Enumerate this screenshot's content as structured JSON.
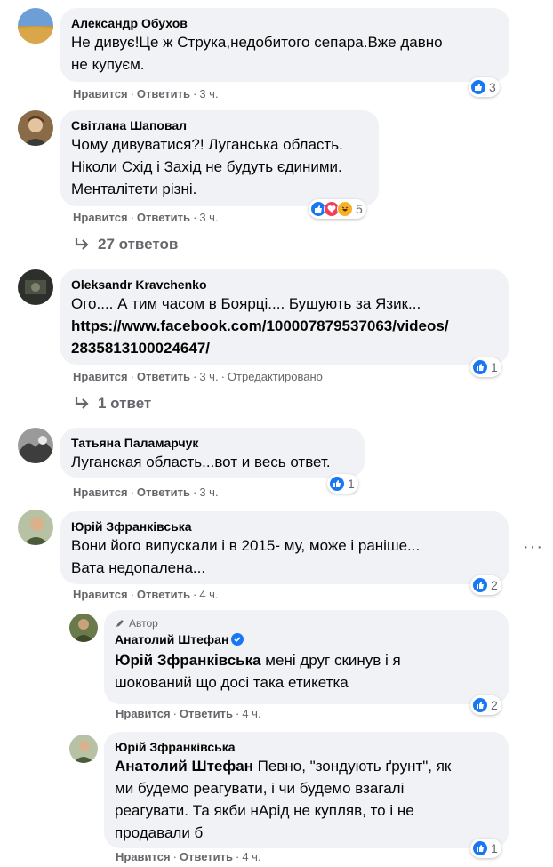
{
  "comments": [
    {
      "author": "Александр Обухов",
      "text": "Не дивує!Це ж Струка,недобитого сепара.Вже давно\nне купуєм.",
      "like": "Нравится",
      "reply": "Ответить",
      "time": "3 ч.",
      "reactions": "3"
    },
    {
      "author": "Світлана Шаповал",
      "text": "Чому дивуватися?! Луганська область.\nНіколи Схід і Захід не будуть єдиними.\nМенталітети різні.",
      "like": "Нравится",
      "reply": "Ответить",
      "time": "3 ч.",
      "reactions": "5",
      "replies": "27 ответов"
    },
    {
      "author": "Oleksandr Kravchenko",
      "text": "Ого.... А тим часом в Боярці.... Бушують за Язик...",
      "link": "https://www.facebook.com/100007879537063/videos/\n2835813100024647/",
      "like": "Нравится",
      "reply": "Ответить",
      "time": "3 ч.",
      "edited": "Отредактировано",
      "reactions": "1",
      "replies": "1 ответ"
    },
    {
      "author": "Татьяна Паламарчук",
      "text": "Луганская область...вот и весь ответ.",
      "like": "Нравится",
      "reply": "Ответить",
      "time": "3 ч.",
      "reactions": "1"
    },
    {
      "author": "Юрій Зфранківська",
      "text": "Вони його випускали і в 2015- му, може і раніше...\nВата недопалена...",
      "like": "Нравится",
      "reply": "Ответить",
      "time": "4 ч.",
      "reactions": "2",
      "more": "···"
    },
    {
      "badge": "Автор",
      "author": "Анатолий Штефан",
      "mention": "Юрій Зфранківська",
      "text": " мені друг скинув і я\nшокований що досі така етикетка",
      "like": "Нравится",
      "reply": "Ответить",
      "time": "4 ч.",
      "reactions": "2"
    },
    {
      "author": "Юрій Зфранківська",
      "mention": "Анатолий Штефан",
      "text": " Певно, \"зондують ґрунт\", як\nми будемо реагувати, і чи будемо взагалі\nреагувати. Та якби нАрід не купляв, то і не\nпродавали б",
      "like": "Нравится",
      "reply": "Ответить",
      "time": "4 ч.",
      "reactions": "1"
    }
  ],
  "colors": {
    "like_blue": "#1877f2",
    "love_red": "#f33e58",
    "haha_yellow": "#f7b125",
    "bubble": "#f0f2f5",
    "meta_gray": "#65676b"
  },
  "icons": [
    "like-icon",
    "love-icon",
    "haha-icon",
    "reply-arrow-icon",
    "pencil-icon",
    "verified-icon",
    "more-icon"
  ]
}
